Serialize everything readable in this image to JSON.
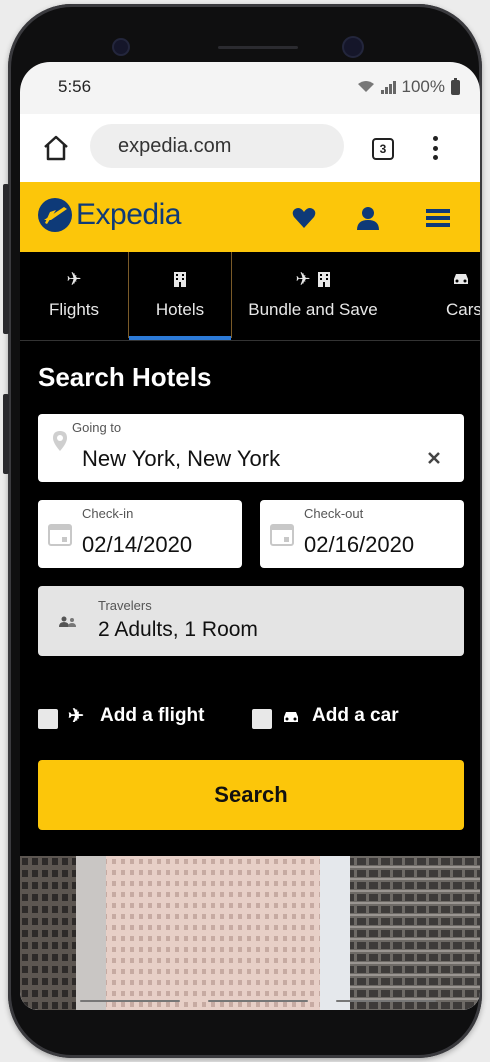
{
  "status": {
    "time": "5:56",
    "battery": "100%"
  },
  "browser": {
    "url": "expedia.com",
    "tab_count": "3"
  },
  "brand": {
    "name": "Expedia",
    "colors": {
      "yellow": "#fcc60a",
      "navy": "#0e3a78",
      "tab_active": "#2c7ad8"
    }
  },
  "header_icons": [
    "heart-icon",
    "account-icon",
    "menu-icon"
  ],
  "tabs": [
    {
      "label": "Flights",
      "icon": "plane-icon"
    },
    {
      "label": "Hotels",
      "icon": "hotel-icon",
      "active": true
    },
    {
      "label": "Bundle and Save",
      "icon": "plane-hotel-icon"
    },
    {
      "label": "Cars",
      "icon": "car-icon"
    }
  ],
  "form": {
    "title": "Search Hotels",
    "going_to": {
      "label": "Going to",
      "value": "New York, New York"
    },
    "check_in": {
      "label": "Check-in",
      "value": "02/14/2020"
    },
    "check_out": {
      "label": "Check-out",
      "value": "02/16/2020"
    },
    "travelers": {
      "label": "Travelers",
      "value": "2 Adults, 1 Room"
    },
    "add_flight": {
      "label": "Add a flight",
      "checked": false
    },
    "add_car": {
      "label": "Add a car",
      "checked": false
    },
    "search_label": "Search"
  }
}
